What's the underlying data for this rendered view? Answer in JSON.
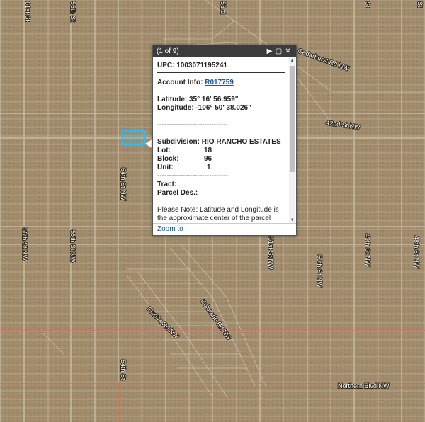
{
  "map": {
    "colors": {
      "terrain": "#a08c6c",
      "parcel_line": "#d8ccb4",
      "arterial": "#d9635c",
      "highlight": "#35b9e9"
    },
    "roads": {
      "r61": "61st St",
      "r55_top": "55th St",
      "r53": "53rd",
      "r56": "56th St NW",
      "r55": "55th St NW",
      "r54": "54th St NW",
      "r54_bottom": "54th St",
      "r51": "51st St NW",
      "r50": "50th St NW",
      "r49": "49th St NW",
      "r48": "48th St NW",
      "r42": "42nd St NW",
      "cedarhurst": "Cedarhurst Rd NW",
      "florida": "Florida Rd NW",
      "colorado": "Colorado Rd NW",
      "northern": "Northern Blvd NW",
      "edge_top": "St",
      "edge_top2": "St"
    }
  },
  "popup": {
    "count": "(1 of 9)",
    "upc": "UPC: 1003071195241",
    "account_label": "Account Info:",
    "account_link": "R017759",
    "latitude": "Latitude: 35° 16' 56.959\"",
    "longitude": "Longitude: -106° 50' 38.026\"",
    "divider": "------------------------------",
    "subdivision": "Subdivision: RIO RANCHO ESTATES",
    "lot_label": "Lot:",
    "lot_value": "18",
    "block_label": "Block:",
    "block_value": "96",
    "unit_label": "Unit:",
    "unit_value": "1",
    "tract": "Tract:",
    "parcel": "Parcel Des.:",
    "note": "Please Note: Latitude and Longitude is the approximate center of the parcel shown.",
    "zoom": "Zoom to",
    "icons": {
      "play": "play-icon",
      "maximize": "maximize-icon",
      "close": "close-icon"
    }
  }
}
